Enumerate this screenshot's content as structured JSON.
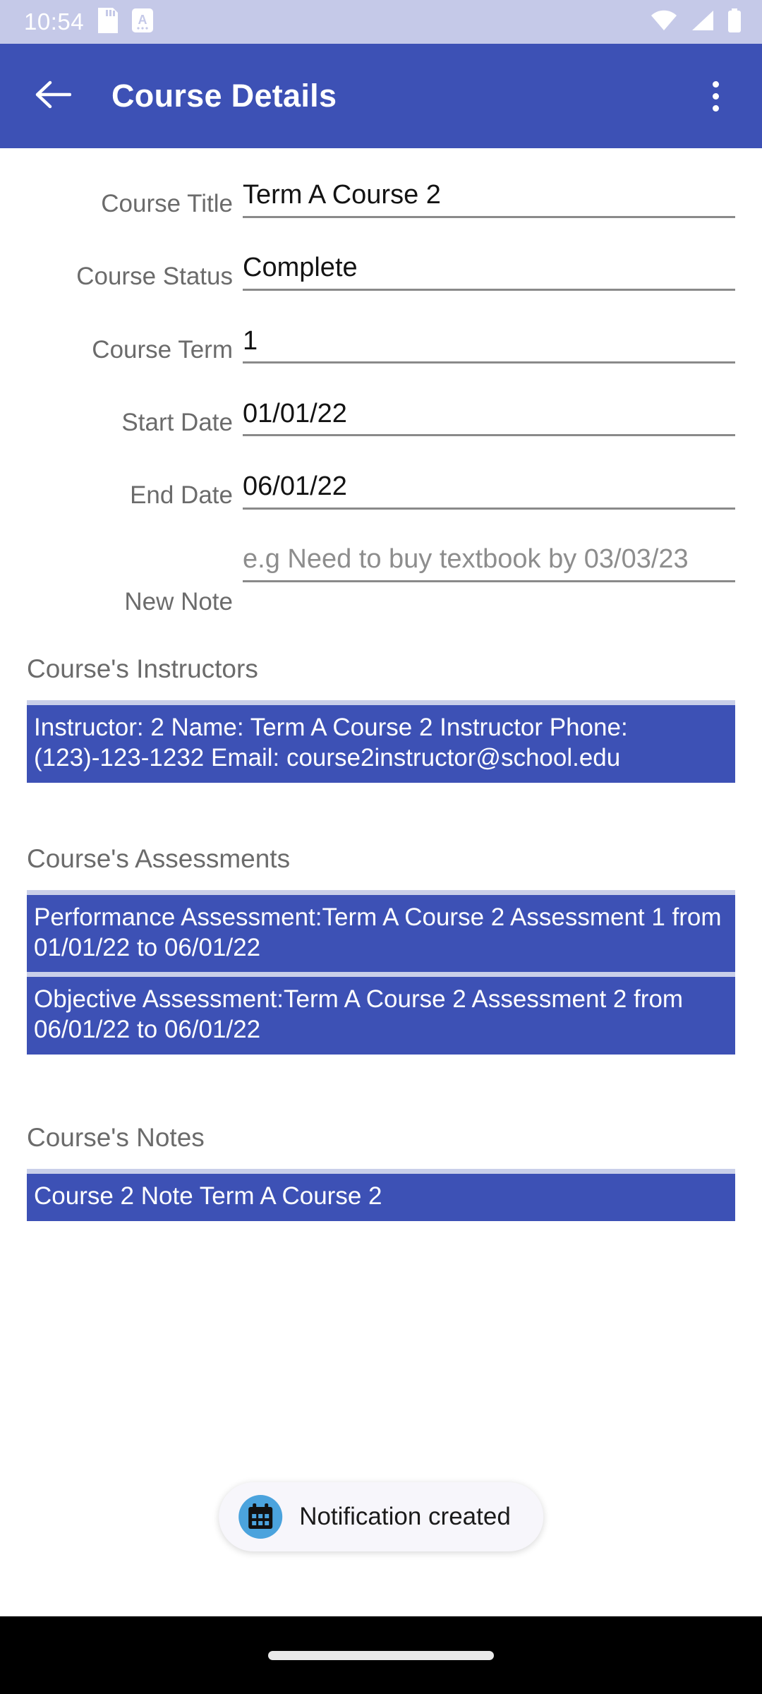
{
  "status_bar": {
    "time": "10:54",
    "left_icons": [
      "sd-card-icon",
      "screenshot-a-icon"
    ],
    "right_icons": [
      "wifi-icon",
      "cell-signal-icon",
      "battery-icon"
    ],
    "background_color": "#c5c9e8"
  },
  "app_bar": {
    "title": "Course Details",
    "back_icon": "back-arrow-icon",
    "overflow_icon": "overflow-menu-icon",
    "background_color": "#3d51b5",
    "text_color": "#ffffff"
  },
  "form": {
    "fields": [
      {
        "label": "Course Title",
        "value": "Term A Course 2",
        "is_placeholder": false
      },
      {
        "label": "Course Status",
        "value": "Complete",
        "is_placeholder": false
      },
      {
        "label": "Course Term",
        "value": "1",
        "is_placeholder": false
      },
      {
        "label": "Start Date",
        "value": "01/01/22",
        "is_placeholder": false
      },
      {
        "label": "End Date",
        "value": "06/01/22",
        "is_placeholder": false
      },
      {
        "label": "New Note",
        "value": "e.g Need to buy textbook by 03/03/23",
        "is_placeholder": true
      }
    ]
  },
  "sections": {
    "instructors": {
      "heading": "Course's Instructors",
      "items": [
        "Instructor: 2 Name: Term A Course 2 Instructor Phone: (123)-123-1232 Email: course2instructor@school.edu"
      ]
    },
    "assessments": {
      "heading": "Course's Assessments",
      "items": [
        "Performance Assessment:Term A Course 2 Assessment 1 from 01/01/22 to 06/01/22",
        "Objective Assessment:Term A Course 2 Assessment 2 from 06/01/22 to 06/01/22"
      ]
    },
    "notes": {
      "heading": "Course's Notes",
      "items": [
        "Course 2 Note  Term A Course 2"
      ]
    }
  },
  "toast": {
    "message": "Notification created",
    "icon": "calendar-icon",
    "background_color": "#f7f6fb",
    "icon_circle_color": "#4ba3dd"
  },
  "nav_bar": {
    "handle": "gesture-home-handle",
    "background_color": "#000000"
  },
  "theme": {
    "primary": "#3d51b5",
    "list_divider": "#c9cfe9",
    "label_gray": "#6b6b6b",
    "underline_gray": "#8a8a8a"
  }
}
